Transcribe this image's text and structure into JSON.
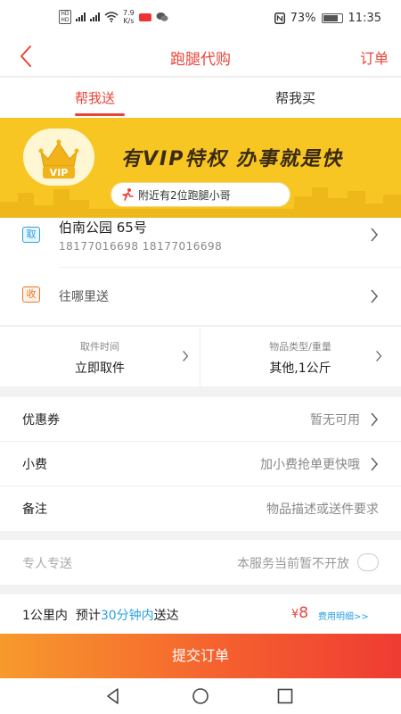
{
  "status_bar": {
    "speed_value": "7.9",
    "speed_unit": "K/s",
    "battery": "73%",
    "battery_level": 0.73,
    "time": "11:35"
  },
  "nav": {
    "title": "跑腿代购",
    "orders": "订单"
  },
  "tabs": [
    {
      "label": "帮我送",
      "active": true
    },
    {
      "label": "帮我买",
      "active": false
    }
  ],
  "banner": {
    "badge_text": "VIP",
    "headline": "有VIP特权  办事就是快",
    "nearby": "附近有2位跑腿小哥"
  },
  "pickup": {
    "tag": "取",
    "address": "伯南公园 65号",
    "phones": "18177016698   18177016698"
  },
  "delivery": {
    "tag": "收",
    "placeholder": "往哪里送"
  },
  "info": {
    "pickup_time_label": "取件时间",
    "pickup_time_value": "立即取件",
    "item_label": "物品类型/重量",
    "item_value": "其他,1公斤"
  },
  "options": {
    "coupon_label": "优惠券",
    "coupon_value": "暂无可用",
    "tip_label": "小费",
    "tip_value": "加小费抢单更快哦",
    "note_label": "备注",
    "note_value": "物品描述或送件要求"
  },
  "exclusive": {
    "label": "专人专送",
    "value": "本服务当前暂不开放"
  },
  "summary": {
    "distance": "1公里内",
    "eta_prefix": "预计",
    "eta_time": "30分钟内",
    "eta_suffix": "送达",
    "currency": "¥",
    "price": "8",
    "fee_link": "费用明细>>"
  },
  "submit_label": "提交订单",
  "colors": {
    "accent": "#e8443a",
    "link": "#2aa1e0",
    "banner": "#f7c623"
  }
}
